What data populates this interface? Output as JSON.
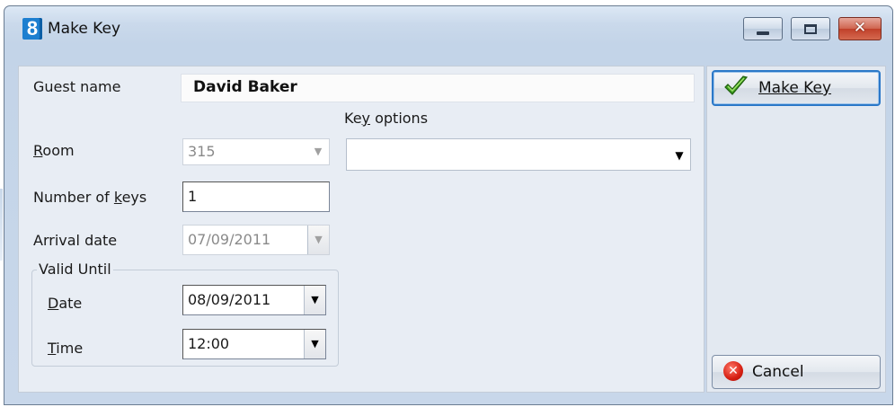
{
  "window": {
    "title": "Make Key",
    "icon": "app-8-icon",
    "accent_color": "#1d7fd0",
    "controls": {
      "minimize": "",
      "maximize": "",
      "close": "✕"
    }
  },
  "form": {
    "guest_name": {
      "label": "Guest name",
      "value": "David Baker"
    },
    "room": {
      "label": "Room",
      "value": "315"
    },
    "number_of_keys": {
      "label": "Number of keys",
      "value": "1"
    },
    "arrival_date": {
      "label": "Arrival date",
      "value": "07/09/2011"
    },
    "key_options": {
      "label": "Key options",
      "value": ""
    },
    "valid_until": {
      "title": "Valid Until",
      "date": {
        "label": "Date",
        "value": "08/09/2011"
      },
      "time": {
        "label": "Time",
        "value": "12:00"
      }
    }
  },
  "buttons": {
    "make_key": "Make Key",
    "cancel": "Cancel"
  }
}
